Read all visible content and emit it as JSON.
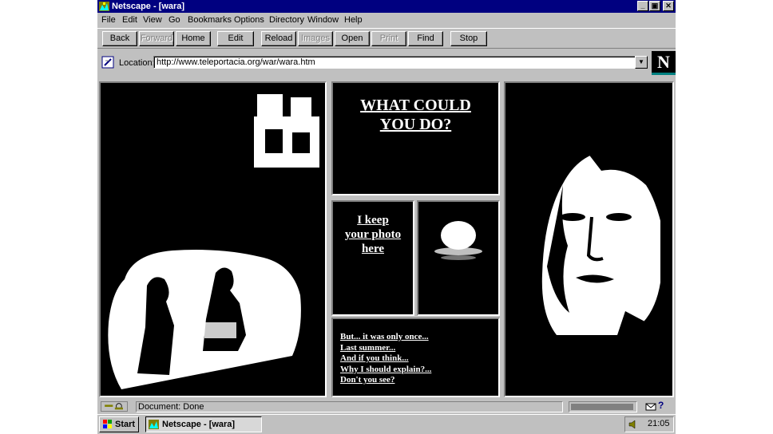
{
  "window": {
    "title": "Netscape - [wara]",
    "controls": {
      "minimize": "_",
      "restore": "▣",
      "close": "✕"
    }
  },
  "menu": [
    {
      "label": "File"
    },
    {
      "label": "Edit"
    },
    {
      "label": "View"
    },
    {
      "label": "Go"
    },
    {
      "label": "Bookmarks"
    },
    {
      "label": "Options"
    },
    {
      "label": "Directory"
    },
    {
      "label": "Window"
    },
    {
      "label": "Help"
    }
  ],
  "toolbar": [
    {
      "label": "Back",
      "enabled": true
    },
    {
      "label": "Forward",
      "enabled": false
    },
    {
      "label": "Home",
      "enabled": true
    },
    {
      "label": "Edit",
      "enabled": true
    },
    {
      "label": "Reload",
      "enabled": true
    },
    {
      "label": "Images",
      "enabled": false
    },
    {
      "label": "Open",
      "enabled": true
    },
    {
      "label": "Print",
      "enabled": false
    },
    {
      "label": "Find",
      "enabled": true
    },
    {
      "label": "Stop",
      "enabled": true
    }
  ],
  "location": {
    "label": "Location:",
    "url": "http://www.teleportacia.org/war/wara.htm",
    "logo_letter": "N"
  },
  "page": {
    "headline_line1": "WHAT COULD",
    "headline_line2": "YOU DO?",
    "photo_link_line1": "I keep",
    "photo_link_line2": "your photo",
    "photo_link_line3": "here",
    "links": [
      "But... it was only once...",
      "Last summer...",
      "And if you think...",
      "Why I should explain?...",
      "Don't you see?"
    ]
  },
  "status": {
    "text": "Document: Done",
    "progress_fraction": 1.0
  },
  "taskbar": {
    "start_label": "Start",
    "task_label": "Netscape - [wara]",
    "clock": "21:05"
  },
  "colors": {
    "titlebar": "#000080",
    "chrome": "#c0c0c0",
    "page_background": "#000000",
    "link": "#ffffff"
  }
}
